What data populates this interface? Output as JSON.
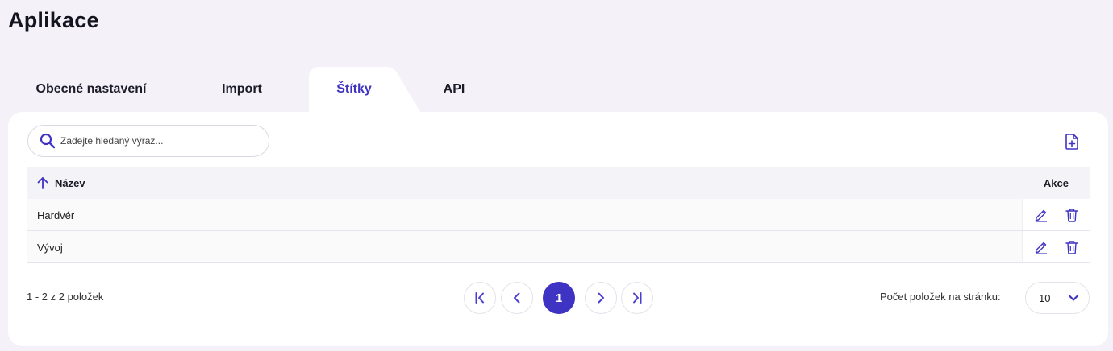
{
  "page": {
    "title": "Aplikace"
  },
  "tabs": [
    {
      "label": "Obecné nastavení",
      "active": false
    },
    {
      "label": "Import",
      "active": false
    },
    {
      "label": "Štítky",
      "active": true
    },
    {
      "label": "API",
      "active": false
    }
  ],
  "search": {
    "placeholder": "Zadejte hledaný výraz..."
  },
  "table": {
    "columns": {
      "name": "Název",
      "actions": "Akce"
    },
    "sort": "ascending",
    "rows": [
      {
        "name": "Hardvér"
      },
      {
        "name": "Vývoj"
      }
    ]
  },
  "pagination": {
    "summary": "1 - 2 z 2 položek",
    "current_page": "1",
    "per_page_label": "Počet položek na stránku:",
    "per_page_value": "10"
  },
  "colors": {
    "accent": "#3f33c4",
    "background": "#f4f2f8",
    "card": "#ffffff"
  },
  "icons": {
    "search": "search-icon",
    "add": "add-file-icon",
    "sort": "arrow-up-icon",
    "edit": "pencil-icon",
    "delete": "trash-icon",
    "first": "first-page-icon",
    "prev": "chevron-left-icon",
    "next": "chevron-right-icon",
    "last": "last-page-icon",
    "dropdown": "chevron-down-icon"
  }
}
